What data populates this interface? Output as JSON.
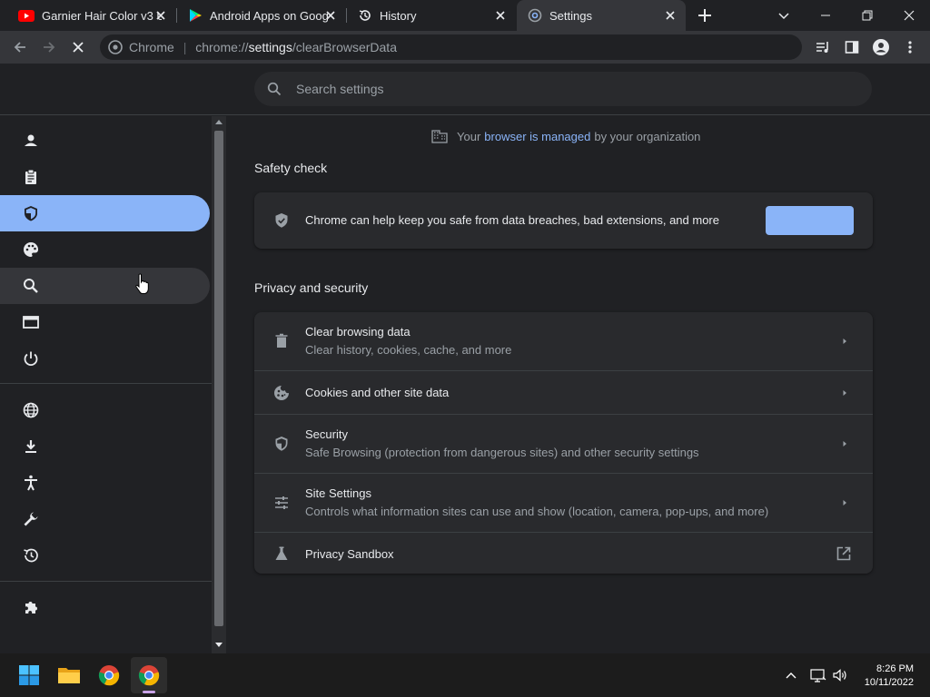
{
  "tabs": [
    {
      "title": "Garnier Hair Color v3 U",
      "icon": "youtube-icon"
    },
    {
      "title": "Android Apps on Goog",
      "icon": "google-play-icon"
    },
    {
      "title": "History",
      "icon": "history-icon"
    },
    {
      "title": "Settings",
      "icon": "settings-gear-icon",
      "active": true
    }
  ],
  "toolbar": {
    "omnibox_site": "Chrome",
    "url_scheme": "chrome://",
    "url_host": "settings",
    "url_path": "/clearBrowserData"
  },
  "search": {
    "placeholder": "Search settings"
  },
  "sidebar": {
    "items": [
      {
        "name": "you-and-google",
        "icon": "person-icon"
      },
      {
        "name": "autofill",
        "icon": "clipboard-icon"
      },
      {
        "name": "privacy-and-security",
        "icon": "shield-icon",
        "selected": true
      },
      {
        "name": "appearance",
        "icon": "palette-icon"
      },
      {
        "name": "search-engine",
        "icon": "search-icon",
        "hovered": true
      },
      {
        "name": "default-browser",
        "icon": "browser-window-icon"
      },
      {
        "name": "on-startup",
        "icon": "power-icon"
      },
      {
        "name": "languages",
        "icon": "globe-icon"
      },
      {
        "name": "downloads",
        "icon": "download-icon"
      },
      {
        "name": "accessibility",
        "icon": "accessibility-icon"
      },
      {
        "name": "system",
        "icon": "wrench-icon"
      },
      {
        "name": "reset-settings",
        "icon": "restore-icon"
      },
      {
        "name": "extensions",
        "icon": "puzzle-icon"
      }
    ]
  },
  "managed": {
    "prefix": "Your",
    "link": "browser is managed",
    "suffix": "by your organization"
  },
  "safety_check": {
    "title": "Safety check",
    "text": "Chrome can help keep you safe from data breaches, bad extensions, and more"
  },
  "privacy": {
    "title": "Privacy and security",
    "rows": [
      {
        "title": "Clear browsing data",
        "subtitle": "Clear history, cookies, cache, and more",
        "icon": "trash-icon"
      },
      {
        "title": "Cookies and other site data",
        "subtitle": "",
        "icon": "cookie-icon"
      },
      {
        "title": "Security",
        "subtitle": "Safe Browsing (protection from dangerous sites) and other security settings",
        "icon": "shield-icon"
      },
      {
        "title": "Site Settings",
        "subtitle": "Controls what information sites can use and show (location, camera, pop-ups, and more)",
        "icon": "sliders-icon"
      },
      {
        "title": "Privacy Sandbox",
        "subtitle": "",
        "icon": "flask-icon"
      }
    ]
  },
  "taskbar": {
    "time": "8:26 PM",
    "date": "10/11/2022"
  },
  "colors": {
    "accent": "#8ab4f8",
    "background": "#202124",
    "card": "#292a2d"
  }
}
